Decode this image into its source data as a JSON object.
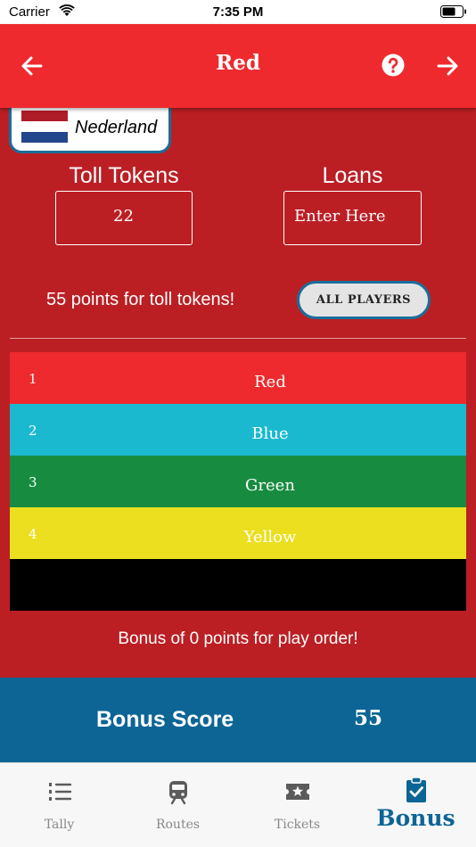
{
  "status": {
    "carrier": "Carrier",
    "time": "7:35 PM"
  },
  "header": {
    "title": "Red",
    "back_icon": "arrow-left-icon",
    "help_icon": "help-circle-icon",
    "next_icon": "arrow-right-icon"
  },
  "country": {
    "name": "Nederland",
    "flag_colors": [
      "#ae1c28",
      "#ffffff",
      "#21468b"
    ]
  },
  "toll_tokens": {
    "label": "Toll Tokens",
    "value": "22"
  },
  "loans": {
    "label": "Loans",
    "placeholder": "Enter Here"
  },
  "toll_message": "55 points for toll tokens!",
  "all_players_label": "ALL PLAYERS",
  "play_order": [
    {
      "num": "1",
      "name": "Red",
      "color": "#ee2a2e"
    },
    {
      "num": "2",
      "name": "Blue",
      "color": "#1ab9cf"
    },
    {
      "num": "3",
      "name": "Green",
      "color": "#178c40"
    },
    {
      "num": "4",
      "name": "Yellow",
      "color": "#ebdf20"
    },
    {
      "num": "",
      "name": "",
      "color": "#000000"
    }
  ],
  "bonus_message": "Bonus of 0 points for play order!",
  "bonus": {
    "label": "Bonus Score",
    "value": "55"
  },
  "tabs": [
    {
      "label": "Tally",
      "icon": "list-icon"
    },
    {
      "label": "Routes",
      "icon": "train-icon"
    },
    {
      "label": "Tickets",
      "icon": "ticket-star-icon"
    },
    {
      "label": "Bonus",
      "icon": "clipboard-check-icon",
      "active": true
    }
  ]
}
